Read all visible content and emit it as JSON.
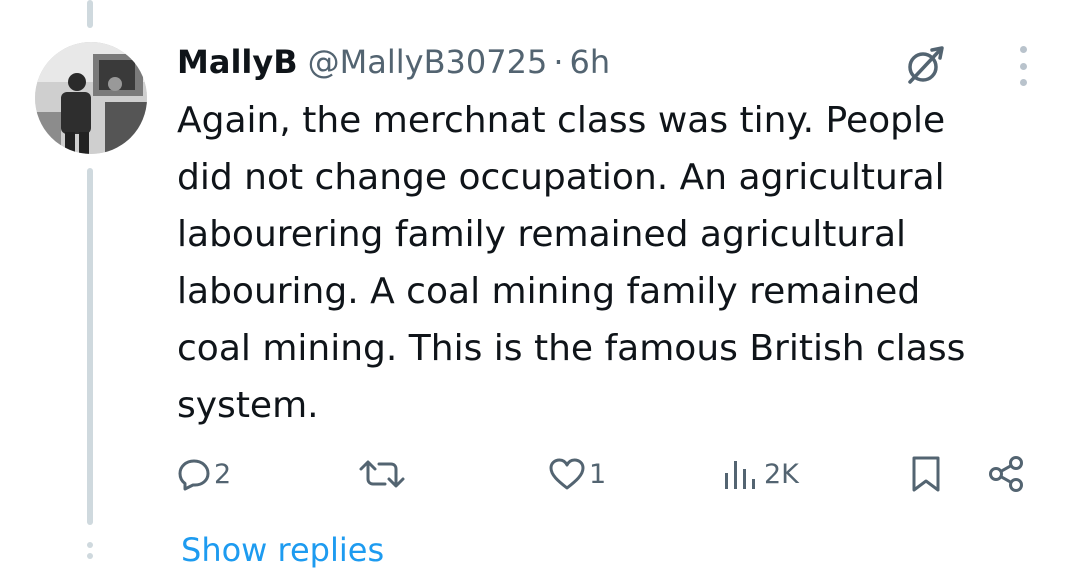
{
  "tweet": {
    "display_name": "MallyB",
    "handle": "@MallyB30725",
    "separator": "·",
    "time": "6h",
    "text": "Again, the merchnat class was tiny. People\ndid not change occupation. An agricultural\nlabourering family remained agricultural\nlabouring. A coal mining family remained\ncoal  mining. This is the famous British class\nsystem.",
    "avatar_icon": "profile-photo",
    "grok_icon": "grok-icon",
    "more_icon": "more-vertical-icon"
  },
  "actions": {
    "reply": {
      "icon": "reply-icon",
      "count": "2"
    },
    "retweet": {
      "icon": "retweet-icon",
      "count": ""
    },
    "like": {
      "icon": "heart-icon",
      "count": "1"
    },
    "views": {
      "icon": "views-icon",
      "count": "2K"
    },
    "bookmark": {
      "icon": "bookmark-icon"
    },
    "share": {
      "icon": "share-icon"
    }
  },
  "thread": {
    "show_replies_label": "Show replies"
  },
  "colors": {
    "text_primary": "#0f1419",
    "text_secondary": "#536471",
    "link": "#1d9bf0",
    "thread_line": "#cfd9de"
  }
}
